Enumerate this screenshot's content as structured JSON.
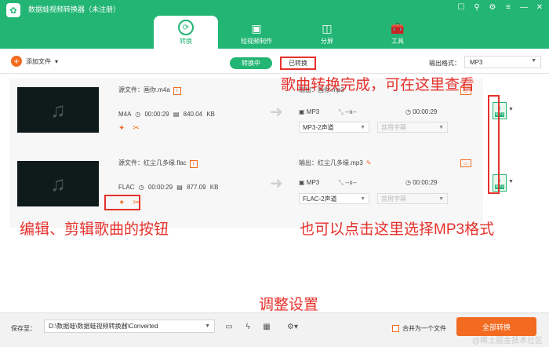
{
  "app": {
    "title": "数据蛙视频转换器（未注册）",
    "logo": "✿",
    "window_controls": [
      "☐",
      "⚲",
      "⚙",
      "≡",
      "—",
      "✕"
    ]
  },
  "nav": [
    {
      "label": "转换",
      "icon": "⟳",
      "active": true
    },
    {
      "label": "短视频制作",
      "icon": "▣",
      "active": false
    },
    {
      "label": "分屏",
      "icon": "◫",
      "active": false
    },
    {
      "label": "工具",
      "icon": "🧰",
      "active": false
    }
  ],
  "toolbar": {
    "add_file": "添加文件",
    "converting": "转换中",
    "converted": "已转换",
    "output_format_label": "输出格式：",
    "output_format_value": "MP3"
  },
  "files": [
    {
      "source": "源文件：画你.m4a",
      "format": "M4A",
      "duration": "00:00:29",
      "size": "840.04 KB",
      "output": "输出：画你.mp3",
      "out_format": "MP3",
      "resolution": "--x--",
      "out_duration": "00:00:29",
      "audio_channel": "MP3-2声道",
      "subtitle": "禁用字幕"
    },
    {
      "source": "源文件：红尘几多缘.flac",
      "format": "FLAC",
      "duration": "00:00:29",
      "size": "877.09 KB",
      "output": "输出：红尘几多缘.mp3",
      "out_format": "MP3",
      "resolution": "--x--",
      "out_duration": "00:00:29",
      "audio_channel": "FLAC-2声道",
      "subtitle": "禁用字幕"
    }
  ],
  "annotations": {
    "converted_hint": "歌曲转换完成，可在这里查看",
    "edit_hint": "编辑、剪辑歌曲的按钮",
    "format_hint": "也可以点击这里选择MP3格式",
    "settings_hint": "调整设置"
  },
  "bottom": {
    "save_to_label": "保存至：",
    "save_path": "D:\\数据蛙\\数据蛙视频转换器\\Converted",
    "merge_label": "合并为一个文件",
    "convert_all": "全部转换",
    "watermark": "@稀土掘金技术社区"
  },
  "colors": {
    "brand": "#22b573",
    "accent": "#f26b21",
    "annotation": "#e5312c"
  }
}
